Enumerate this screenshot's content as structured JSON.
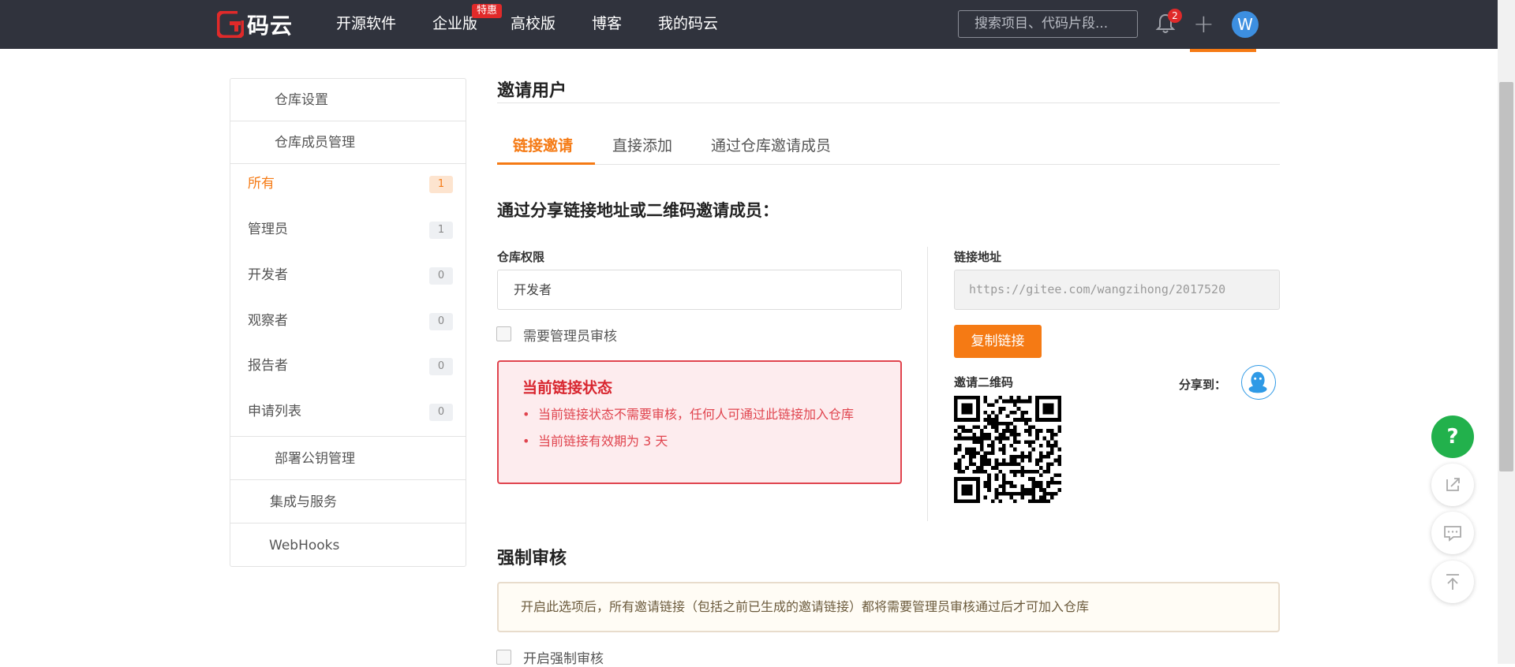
{
  "navbar": {
    "logo_text": "码云",
    "items": [
      "开源软件",
      "企业版",
      "高校版",
      "博客",
      "我的码云"
    ],
    "enterprise_badge": "特惠",
    "my_caret": "",
    "search_placeholder": "搜索项目、代码片段...",
    "notification_count": "2",
    "avatar_letter": "W",
    "avatar_caret": ""
  },
  "sidebar": {
    "repo_settings": "仓库设置",
    "member_mgmt": "仓库成员管理",
    "section_icon": "",
    "members": [
      {
        "label": "所有",
        "count": "1"
      },
      {
        "label": "管理员",
        "count": "1"
      },
      {
        "label": "开发者",
        "count": "0"
      },
      {
        "label": "观察者",
        "count": "0"
      },
      {
        "label": "报告者",
        "count": "0"
      },
      {
        "label": "申请列表",
        "count": "0"
      }
    ],
    "deploy_keys": "部署公钥管理",
    "integrations": "集成与服务",
    "webhooks": "WebHooks"
  },
  "main": {
    "title": "邀请用户",
    "tabs": [
      "链接邀请",
      "直接添加",
      "通过仓库邀请成员"
    ],
    "invite_heading": "通过分享链接地址或二维码邀请成员：",
    "permission_label": "仓库权限",
    "permission_value": "开发者",
    "select_caret": "",
    "need_review_label": "需要管理员审核",
    "status": {
      "title": "当前链接状态",
      "items": [
        "当前链接状态不需要审核，任何人可通过此链接加入仓库",
        "当前链接有效期为 3 天"
      ]
    },
    "link_label": "链接地址",
    "link_value": "https://gitee.com/wangzihong/2017520",
    "copy_button": "复制链接",
    "qr_label": "邀请二维码",
    "share_label": "分享到：",
    "force_title": "强制审核",
    "force_notice": "开启此选项后，所有邀请链接（包括之前已生成的邀请链接）都将需要管理员审核通过后才可加入仓库",
    "force_checkbox_label": "开启强制审核"
  },
  "floating": {
    "help": "?"
  },
  "colors": {
    "nav_bg": "#30333d",
    "accent": "#f57a14",
    "danger": "#e0444e",
    "help_green": "#22b14c",
    "avatar_blue": "#3d8fe0"
  },
  "icons": [
    "gitee-logo-icon",
    "bell-icon",
    "plus-icon",
    "qq-icon",
    "qr-code",
    "share-icon",
    "comment-icon",
    "back-to-top-icon"
  ]
}
